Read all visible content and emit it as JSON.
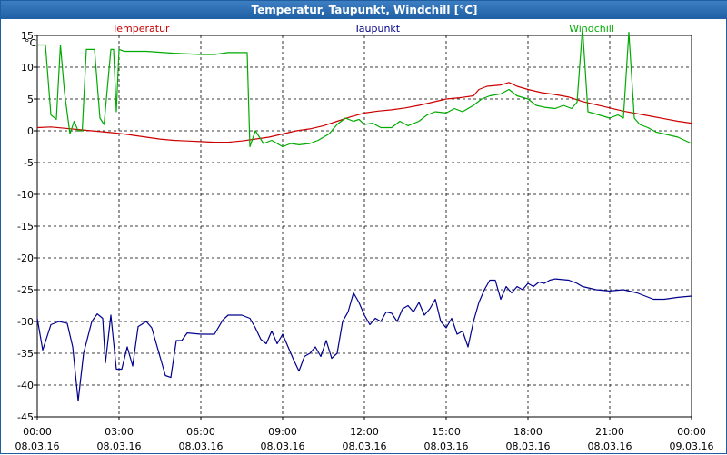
{
  "window": {
    "title": "Temperatur, Taupunkt, Windchill [°C]"
  },
  "chart_data": {
    "type": "line",
    "title": "Temperatur, Taupunkt, Windchill [°C]",
    "ylabel": "°C",
    "ylim": [
      -45,
      15
    ],
    "yticks": [
      15,
      10,
      5,
      0,
      -5,
      -10,
      -15,
      -20,
      -25,
      -30,
      -35,
      -40,
      -45
    ],
    "xlim": [
      0,
      24
    ],
    "xticks": [
      {
        "time": "00:00",
        "date": "08.03.16"
      },
      {
        "time": "03:00",
        "date": "08.03.16"
      },
      {
        "time": "06:00",
        "date": "08.03.16"
      },
      {
        "time": "09:00",
        "date": "08.03.16"
      },
      {
        "time": "12:00",
        "date": "08.03.16"
      },
      {
        "time": "15:00",
        "date": "08.03.16"
      },
      {
        "time": "18:00",
        "date": "08.03.16"
      },
      {
        "time": "21:00",
        "date": "08.03.16"
      },
      {
        "time": "00:00",
        "date": "09.03.16"
      }
    ],
    "grid": true,
    "legend_placement": "top",
    "series": [
      {
        "name": "Temperatur",
        "color": "#cc0000",
        "points": [
          [
            0,
            0.5
          ],
          [
            0.5,
            0.6
          ],
          [
            1,
            0.4
          ],
          [
            1.5,
            0.2
          ],
          [
            2,
            0
          ],
          [
            2.5,
            -0.2
          ],
          [
            3,
            -0.4
          ],
          [
            3.5,
            -0.7
          ],
          [
            4,
            -1
          ],
          [
            4.5,
            -1.3
          ],
          [
            5,
            -1.5
          ],
          [
            5.5,
            -1.6
          ],
          [
            6,
            -1.7
          ],
          [
            6.5,
            -1.8
          ],
          [
            7,
            -1.8
          ],
          [
            7.5,
            -1.6
          ],
          [
            8,
            -1.3
          ],
          [
            8.5,
            -1
          ],
          [
            9,
            -0.5
          ],
          [
            9.5,
            0
          ],
          [
            10,
            0.3
          ],
          [
            10.5,
            0.8
          ],
          [
            11,
            1.5
          ],
          [
            11.5,
            2.2
          ],
          [
            12,
            2.8
          ],
          [
            12.5,
            3.1
          ],
          [
            13,
            3.3
          ],
          [
            13.5,
            3.6
          ],
          [
            14,
            4
          ],
          [
            14.5,
            4.5
          ],
          [
            15,
            5
          ],
          [
            15.5,
            5.2
          ],
          [
            16,
            5.5
          ],
          [
            16.2,
            6.5
          ],
          [
            16.5,
            7
          ],
          [
            17,
            7.2
          ],
          [
            17.3,
            7.6
          ],
          [
            17.6,
            7
          ],
          [
            18,
            6.5
          ],
          [
            18.5,
            6
          ],
          [
            19,
            5.7
          ],
          [
            19.5,
            5.3
          ],
          [
            20,
            4.6
          ],
          [
            20.5,
            4.1
          ],
          [
            21,
            3.6
          ],
          [
            21.5,
            3.1
          ],
          [
            22,
            2.7
          ],
          [
            22.5,
            2.3
          ],
          [
            23,
            1.9
          ],
          [
            23.5,
            1.5
          ],
          [
            24,
            1.2
          ]
        ]
      },
      {
        "name": "Taupunkt",
        "color": "#00008b",
        "points": [
          [
            0,
            -29.5
          ],
          [
            0.2,
            -34.5
          ],
          [
            0.5,
            -30.5
          ],
          [
            0.8,
            -30
          ],
          [
            1.1,
            -30.3
          ],
          [
            1.3,
            -34
          ],
          [
            1.5,
            -42.5
          ],
          [
            1.7,
            -35
          ],
          [
            2,
            -30
          ],
          [
            2.2,
            -28.8
          ],
          [
            2.4,
            -29.5
          ],
          [
            2.5,
            -36.5
          ],
          [
            2.7,
            -29
          ],
          [
            2.9,
            -37.5
          ],
          [
            3.1,
            -37.5
          ],
          [
            3.3,
            -34
          ],
          [
            3.5,
            -37
          ],
          [
            3.7,
            -30.8
          ],
          [
            4,
            -30
          ],
          [
            4.2,
            -31
          ],
          [
            4.5,
            -35.5
          ],
          [
            4.7,
            -38.5
          ],
          [
            4.9,
            -38.8
          ],
          [
            5.1,
            -33
          ],
          [
            5.3,
            -33
          ],
          [
            5.5,
            -31.8
          ],
          [
            6,
            -32
          ],
          [
            6.5,
            -32
          ],
          [
            6.8,
            -29.8
          ],
          [
            7,
            -29
          ],
          [
            7.5,
            -29
          ],
          [
            7.8,
            -29.5
          ],
          [
            8,
            -31
          ],
          [
            8.2,
            -32.8
          ],
          [
            8.4,
            -33.5
          ],
          [
            8.6,
            -31.5
          ],
          [
            8.8,
            -33.5
          ],
          [
            9,
            -32
          ],
          [
            9.2,
            -34
          ],
          [
            9.4,
            -36
          ],
          [
            9.6,
            -37.8
          ],
          [
            9.8,
            -35.5
          ],
          [
            10,
            -35
          ],
          [
            10.2,
            -34
          ],
          [
            10.4,
            -35.5
          ],
          [
            10.6,
            -33
          ],
          [
            10.8,
            -35.8
          ],
          [
            11,
            -35
          ],
          [
            11.2,
            -30
          ],
          [
            11.4,
            -28.5
          ],
          [
            11.6,
            -25.5
          ],
          [
            11.8,
            -27
          ],
          [
            12,
            -29
          ],
          [
            12.2,
            -30.5
          ],
          [
            12.4,
            -29.5
          ],
          [
            12.6,
            -30
          ],
          [
            12.8,
            -28.5
          ],
          [
            13,
            -28.7
          ],
          [
            13.2,
            -30
          ],
          [
            13.4,
            -28
          ],
          [
            13.6,
            -27.5
          ],
          [
            13.8,
            -28.5
          ],
          [
            14,
            -27
          ],
          [
            14.2,
            -29
          ],
          [
            14.4,
            -28
          ],
          [
            14.6,
            -26.5
          ],
          [
            14.8,
            -30
          ],
          [
            15,
            -31
          ],
          [
            15.2,
            -29.5
          ],
          [
            15.4,
            -32
          ],
          [
            15.6,
            -31.5
          ],
          [
            15.8,
            -34
          ],
          [
            16,
            -30
          ],
          [
            16.2,
            -27
          ],
          [
            16.4,
            -25
          ],
          [
            16.6,
            -23.5
          ],
          [
            16.8,
            -23.5
          ],
          [
            17,
            -26.5
          ],
          [
            17.2,
            -24.5
          ],
          [
            17.4,
            -25.5
          ],
          [
            17.6,
            -24.5
          ],
          [
            17.8,
            -25
          ],
          [
            18,
            -24
          ],
          [
            18.2,
            -24.5
          ],
          [
            18.4,
            -23.8
          ],
          [
            18.6,
            -24
          ],
          [
            18.8,
            -23.5
          ],
          [
            19,
            -23.3
          ],
          [
            19.5,
            -23.5
          ],
          [
            19.8,
            -24
          ],
          [
            20,
            -24.5
          ],
          [
            20.5,
            -25
          ],
          [
            21,
            -25.2
          ],
          [
            21.5,
            -25
          ],
          [
            22,
            -25.5
          ],
          [
            22.3,
            -26
          ],
          [
            22.6,
            -26.5
          ],
          [
            23,
            -26.5
          ],
          [
            23.5,
            -26.2
          ],
          [
            24,
            -26
          ]
        ]
      },
      {
        "name": "Windchill",
        "color": "#00aa00",
        "points": [
          [
            0,
            13.5
          ],
          [
            0.3,
            13.5
          ],
          [
            0.5,
            2.5
          ],
          [
            0.7,
            1.8
          ],
          [
            0.85,
            13.5
          ],
          [
            1.0,
            6
          ],
          [
            1.2,
            -0.5
          ],
          [
            1.35,
            1.5
          ],
          [
            1.5,
            0
          ],
          [
            1.65,
            0
          ],
          [
            1.8,
            12.8
          ],
          [
            2.1,
            12.8
          ],
          [
            2.3,
            2
          ],
          [
            2.45,
            1
          ],
          [
            2.7,
            12.8
          ],
          [
            2.8,
            12.8
          ],
          [
            2.9,
            3
          ],
          [
            3.0,
            12.8
          ],
          [
            3.2,
            12.5
          ],
          [
            4,
            12.5
          ],
          [
            5,
            12.2
          ],
          [
            6,
            12
          ],
          [
            6.5,
            12
          ],
          [
            7,
            12.3
          ],
          [
            7.7,
            12.3
          ],
          [
            7.8,
            -2.5
          ],
          [
            8,
            0
          ],
          [
            8.3,
            -2
          ],
          [
            8.6,
            -1.5
          ],
          [
            9,
            -2.5
          ],
          [
            9.3,
            -2
          ],
          [
            9.6,
            -2.2
          ],
          [
            10,
            -2
          ],
          [
            10.3,
            -1.5
          ],
          [
            10.7,
            -0.5
          ],
          [
            11,
            1
          ],
          [
            11.3,
            2
          ],
          [
            11.6,
            1.5
          ],
          [
            11.8,
            1.8
          ],
          [
            12,
            1
          ],
          [
            12.3,
            1.2
          ],
          [
            12.6,
            0.5
          ],
          [
            13,
            0.5
          ],
          [
            13.3,
            1.5
          ],
          [
            13.6,
            0.8
          ],
          [
            14,
            1.5
          ],
          [
            14.3,
            2.5
          ],
          [
            14.6,
            3
          ],
          [
            15,
            2.8
          ],
          [
            15.3,
            3.5
          ],
          [
            15.6,
            3
          ],
          [
            16,
            4
          ],
          [
            16.3,
            5
          ],
          [
            16.6,
            5.5
          ],
          [
            17,
            5.8
          ],
          [
            17.3,
            6.5
          ],
          [
            17.6,
            5.5
          ],
          [
            18,
            5
          ],
          [
            18.3,
            4
          ],
          [
            18.6,
            3.7
          ],
          [
            19,
            3.5
          ],
          [
            19.3,
            4
          ],
          [
            19.6,
            3.5
          ],
          [
            19.8,
            4.5
          ],
          [
            20,
            16.2
          ],
          [
            20.2,
            3
          ],
          [
            20.6,
            2.5
          ],
          [
            21,
            2
          ],
          [
            21.3,
            2.5
          ],
          [
            21.5,
            2
          ],
          [
            21.7,
            15.5
          ],
          [
            21.9,
            2
          ],
          [
            22.1,
            1
          ],
          [
            22.4,
            0.5
          ],
          [
            22.7,
            -0.2
          ],
          [
            23,
            -0.5
          ],
          [
            23.5,
            -1
          ],
          [
            24,
            -2
          ]
        ]
      }
    ]
  }
}
